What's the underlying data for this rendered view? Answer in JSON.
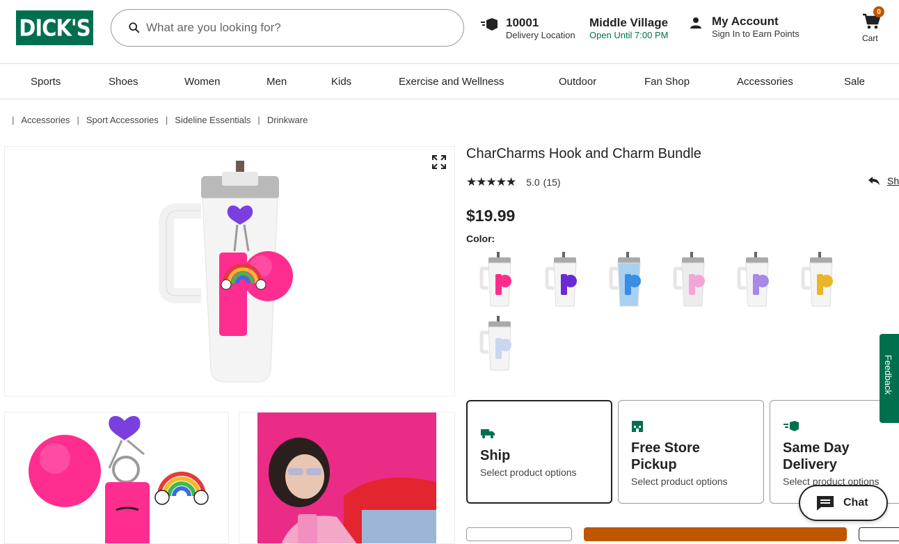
{
  "header": {
    "logo_text": "DICK'S",
    "search_placeholder": "What are you looking for?",
    "zip": "10001",
    "delivery_label": "Delivery Location",
    "store_name": "Middle Village",
    "store_hours": "Open Until 7:00 PM",
    "account_title": "My Account",
    "account_sub": "Sign In to Earn Points",
    "cart_label": "Cart",
    "cart_count": "0"
  },
  "nav": [
    "Sports",
    "Shoes",
    "Women",
    "Men",
    "Kids",
    "Exercise and Wellness",
    "Outdoor",
    "Fan Shop",
    "Accessories",
    "Sale"
  ],
  "breadcrumb": [
    "Accessories",
    "Sport Accessories",
    "Sideline Essentials",
    "Drinkware"
  ],
  "product": {
    "title": "CharCharms Hook and Charm Bundle",
    "stars": "★★★★★",
    "rating": "5.0",
    "reviews": "(15)",
    "share": "Sh",
    "price": "$19.99",
    "color_label": "Color:"
  },
  "swatches": [
    {
      "name": "pink-rainbow",
      "accent": "#ff2d8f",
      "tumbler": "#f4f4f4"
    },
    {
      "name": "purple-green",
      "accent": "#6a2bd6",
      "tumbler": "#f4f4f4"
    },
    {
      "name": "blue-dots",
      "accent": "#3a8de0",
      "tumbler": "#a9d0f0"
    },
    {
      "name": "pink-pompom",
      "accent": "#f3a6d6",
      "tumbler": "#ececec"
    },
    {
      "name": "purple-lavender",
      "accent": "#a888e8",
      "tumbler": "#f4f4f4"
    },
    {
      "name": "yellow-leopard",
      "accent": "#e9b52b",
      "tumbler": "#f4f4f4"
    },
    {
      "name": "white-clear",
      "accent": "#c9d6f0",
      "tumbler": "#f4f4f4"
    }
  ],
  "fulfillment": [
    {
      "title": "Ship",
      "sub": "Select product options",
      "icon": "truck-icon"
    },
    {
      "title": "Free Store Pickup",
      "sub": "Select product options",
      "icon": "store-icon"
    },
    {
      "title": "Same Day Delivery",
      "sub": "Select product options",
      "icon": "fast-delivery-icon"
    }
  ],
  "feedback_label": "Feedback",
  "chat_label": "Chat",
  "colors": {
    "brand_green": "#006f50",
    "accent_orange": "#bf5700",
    "pink": "#ff2d8f"
  }
}
